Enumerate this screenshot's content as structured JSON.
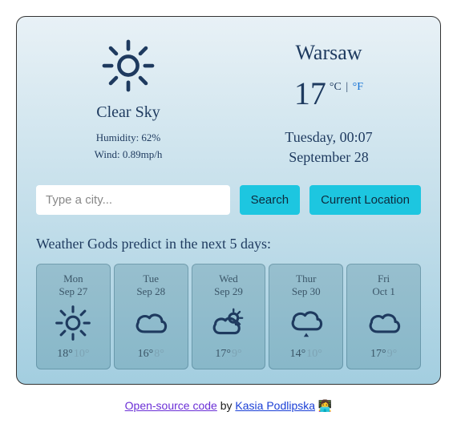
{
  "current": {
    "description": "Clear Sky",
    "humidity_label": "Humidity: 62%",
    "wind_label": "Wind: 0.89mp/h",
    "city": "Warsaw",
    "temp": "17",
    "unit_c": "°C",
    "unit_sep": "|",
    "unit_f": "°F",
    "day_time": "Tuesday, 00:07",
    "date": "September 28",
    "icon": "sun"
  },
  "controls": {
    "placeholder": "Type a city...",
    "search_label": "Search",
    "location_label": "Current Location"
  },
  "forecast": {
    "title": "Weather Gods predict in the next 5 days:",
    "days": [
      {
        "dow": "Mon",
        "date": "Sep 27",
        "icon": "sun",
        "hi": "18°",
        "lo": "10°"
      },
      {
        "dow": "Tue",
        "date": "Sep 28",
        "icon": "cloud",
        "hi": "16°",
        "lo": "8°"
      },
      {
        "dow": "Wed",
        "date": "Sep 29",
        "icon": "partly",
        "hi": "17°",
        "lo": "9°"
      },
      {
        "dow": "Thur",
        "date": "Sep 30",
        "icon": "rain",
        "hi": "14°",
        "lo": "10°"
      },
      {
        "dow": "Fri",
        "date": "Oct 1",
        "icon": "cloud",
        "hi": "17°",
        "lo": "9°"
      }
    ]
  },
  "footer": {
    "code_link": "Open-source code",
    "by": " by ",
    "author": "Kasia Podlipska",
    "emoji": " 👩‍💻"
  }
}
